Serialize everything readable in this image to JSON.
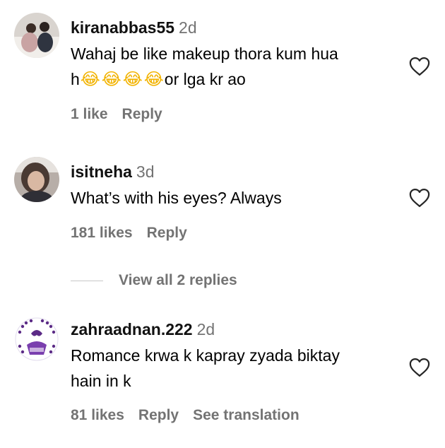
{
  "comments": [
    {
      "username": "kiranabbas55",
      "time": "2d",
      "text_line1": "Wahaj be like makeup thora kum hua",
      "text_line2_prefix": "h",
      "emojis": [
        "😂",
        "😂",
        "😂",
        "😂"
      ],
      "text_line2_suffix": "or lga kr ao",
      "likes": "1 like",
      "reply": "Reply",
      "avatar_icon": "profile-photo-couple"
    },
    {
      "username": "isitneha",
      "time": "3d",
      "text_line1": "What’s with his eyes? Always",
      "likes": "181 likes",
      "reply": "Reply",
      "avatar_icon": "profile-photo-woman"
    },
    {
      "username": "zahraadnan.222",
      "time": "2d",
      "text_line1": "Romance krwa k kapray zyada biktay",
      "text_line2": "hain in k",
      "likes": "81 likes",
      "reply": "Reply",
      "see_translation": "See translation",
      "avatar_icon": "profile-photo-calligraphy-purple"
    }
  ],
  "view_replies": "View all 2 replies",
  "colors": {
    "secondary_text": "#737373",
    "divider": "#c7c7c7",
    "avatar_purple": "#5b2a86"
  },
  "icons": {
    "like": "heart-outline-icon"
  }
}
